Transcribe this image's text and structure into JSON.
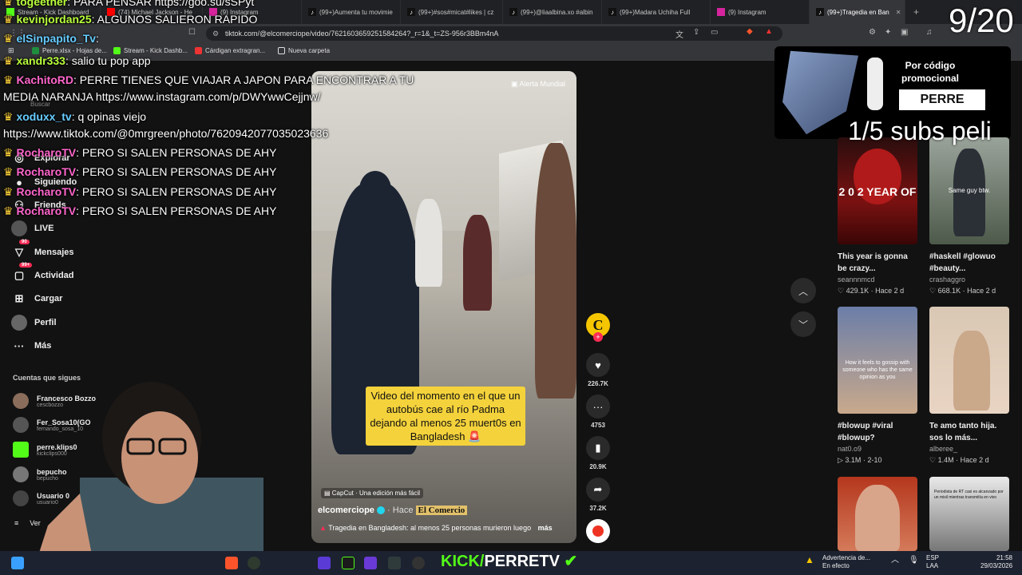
{
  "browser": {
    "tabs": [
      {
        "label": "Stream - Kick Dashboard",
        "icon": "kick-icon"
      },
      {
        "label": "(74) Michael Jackson - He",
        "icon": "youtube-icon"
      },
      {
        "label": "(9) Instagram",
        "icon": "instagram-icon"
      },
      {
        "label": "(99+)Aumenta tu movimie",
        "icon": "tiktok-icon"
      },
      {
        "label": "(99+)#sos#micat#likes | cz",
        "icon": "tiktok-icon"
      },
      {
        "label": "(99+)@liaalbina.xo #albin",
        "icon": "tiktok-icon"
      },
      {
        "label": "(99+)Madara Uchiha Full",
        "icon": "tiktok-icon"
      },
      {
        "label": "(9) Instagram",
        "icon": "instagram-icon"
      },
      {
        "label": "(99+)Tragedia en Ban",
        "icon": "tiktok-icon",
        "active": true
      }
    ],
    "url": "tiktok.com/@elcomerciope/video/7621603659251584264?_r=1&_t=ZS-956r3BBm4nA",
    "bookmarks": [
      "Perre.xlsx - Hojas de...",
      "Stream - Kick Dashb...",
      "Cárdigan extragran...",
      "Nueva carpeta"
    ]
  },
  "sidebar": {
    "search_placeholder": "Buscar",
    "items": [
      {
        "label": "Explorar",
        "icon": "compass-icon"
      },
      {
        "label": "Siguiendo",
        "icon": "following-icon"
      },
      {
        "label": "Friends",
        "icon": "friends-icon"
      },
      {
        "label": "LIVE",
        "icon": "live-icon"
      },
      {
        "label": "Mensajes",
        "icon": "message-icon",
        "badge": "90"
      },
      {
        "label": "Actividad",
        "icon": "activity-icon",
        "badge": "99+"
      },
      {
        "label": "Cargar",
        "icon": "upload-icon"
      },
      {
        "label": "Perfil",
        "icon": "profile-icon"
      },
      {
        "label": "Más",
        "icon": "more-icon"
      }
    ],
    "following_title": "Cuentas que sigues",
    "following": [
      {
        "name": "Francesco Bozzo",
        "handle": "cescbozzo"
      },
      {
        "name": "Fer_Sosa10(GO",
        "handle": "fernando_sosa_10"
      },
      {
        "name": "perre.klips0",
        "handle": "kickclips000"
      },
      {
        "name": "bepucho",
        "handle": "bepucho"
      },
      {
        "name": "Usuario 0",
        "handle": "usuario0"
      }
    ],
    "see_more": "Ver"
  },
  "video": {
    "alert_tag": "Alerta Mundial",
    "caption": "Video del momento en el que un autobús cae al río Padma dejando al menos 25 muert0s en Bangladesh 🚨",
    "capcut": "CapCut · Una edición más fácil",
    "author": "elcomerciope",
    "time": "· Hace",
    "watermark": "El Comercio",
    "description": "Tragedia en Bangladesh: al menos 25 personas murieron luego",
    "more": "más"
  },
  "actions": {
    "likes": "226.7K",
    "comments": "4753",
    "saves": "20.9K",
    "shares": "37.2K"
  },
  "promo": {
    "text": "Por código promocional",
    "code": "PERRE"
  },
  "feed": [
    {
      "title": "This year is gonna be crazy...",
      "author": "seannnmcd",
      "likes": "429.1K",
      "date": "Hace 2 d",
      "thumb_text": "2 0 2 YEAR OF"
    },
    {
      "title": "#haskell #glowuo #beauty...",
      "author": "crashaggro",
      "likes": "668.1K",
      "date": "Hace 2 d",
      "thumb_text": "Same guy btw."
    },
    {
      "title": "#blowup #viral #blowup?",
      "author": "nat0.o9",
      "likes": "3.1M",
      "date": "2-10",
      "thumb_text": "How it feels to gossip with someone who has the same opinion as you"
    },
    {
      "title": "Te amo tanto hija. sos lo más...",
      "author": "alberee_",
      "likes": "1.4M",
      "date": "Hace 2 d",
      "thumb_text": ""
    },
    {
      "title": "",
      "author": "",
      "likes": "",
      "date": "",
      "thumb_text": ""
    },
    {
      "title": "",
      "author": "",
      "likes": "",
      "date": "",
      "thumb_text": "Periodista de RT casi es alcanzado por un misil mientras transmitía en vivo"
    }
  ],
  "stream": {
    "counter": "9/20",
    "subs_goal": "1/5 subs peli",
    "brand_pre": "KICK/",
    "brand": "PERRETV",
    "chat": [
      {
        "user": "togeether",
        "msg": ": PARA PENSAR https://goo.su/sSPyt"
      },
      {
        "user": "kevinjordan25",
        "msg": ": ALGUNOS SALIERON RAPIDO"
      },
      {
        "user": "elSinpapito_Tv",
        "msg": ":"
      },
      {
        "user": "xandr333",
        "msg": ": salio tu pop app"
      },
      {
        "user": "KachitoRD",
        "msg": ": PERRE TIENES QUE VIAJAR A JAPON PARA ENCONTRAR A TU"
      },
      {
        "user": "",
        "msg": "MEDIA NARANJA https://www.instagram.com/p/DWYwwCejjnw/"
      },
      {
        "user": "xoduxx_tv",
        "msg": ": q opinas viejo"
      },
      {
        "user": "",
        "msg": "https://www.tiktok.com/@0mrgreen/photo/7620942077035023636"
      },
      {
        "user": "RocharoTV",
        "msg": ": PERO SI SALEN PERSONAS DE AHY"
      },
      {
        "user": "RocharoTV",
        "msg": ": PERO SI SALEN PERSONAS DE AHY"
      },
      {
        "user": "RocharoTV",
        "msg": ": PERO SI SALEN PERSONAS DE AHY"
      },
      {
        "user": "RocharoTV",
        "msg": ": PERO SI SALEN PERSONAS DE AHY"
      }
    ]
  },
  "taskbar": {
    "warning_title": "Advertencia de...",
    "warning_sub": "En efecto",
    "lang": "ESP",
    "lang_sub": "LAA",
    "time": "21:58",
    "date": "29/03/2026"
  }
}
